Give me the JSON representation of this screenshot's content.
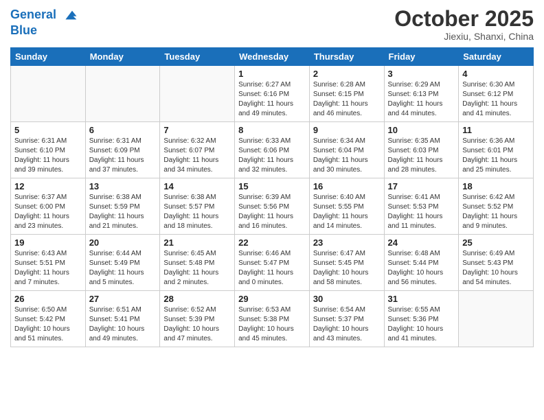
{
  "header": {
    "logo_line1": "General",
    "logo_line2": "Blue",
    "month_title": "October 2025",
    "location": "Jiexiu, Shanxi, China"
  },
  "weekdays": [
    "Sunday",
    "Monday",
    "Tuesday",
    "Wednesday",
    "Thursday",
    "Friday",
    "Saturday"
  ],
  "weeks": [
    [
      {
        "day": "",
        "sunrise": "",
        "sunset": "",
        "daylight": ""
      },
      {
        "day": "",
        "sunrise": "",
        "sunset": "",
        "daylight": ""
      },
      {
        "day": "",
        "sunrise": "",
        "sunset": "",
        "daylight": ""
      },
      {
        "day": "1",
        "sunrise": "Sunrise: 6:27 AM",
        "sunset": "Sunset: 6:16 PM",
        "daylight": "Daylight: 11 hours and 49 minutes."
      },
      {
        "day": "2",
        "sunrise": "Sunrise: 6:28 AM",
        "sunset": "Sunset: 6:15 PM",
        "daylight": "Daylight: 11 hours and 46 minutes."
      },
      {
        "day": "3",
        "sunrise": "Sunrise: 6:29 AM",
        "sunset": "Sunset: 6:13 PM",
        "daylight": "Daylight: 11 hours and 44 minutes."
      },
      {
        "day": "4",
        "sunrise": "Sunrise: 6:30 AM",
        "sunset": "Sunset: 6:12 PM",
        "daylight": "Daylight: 11 hours and 41 minutes."
      }
    ],
    [
      {
        "day": "5",
        "sunrise": "Sunrise: 6:31 AM",
        "sunset": "Sunset: 6:10 PM",
        "daylight": "Daylight: 11 hours and 39 minutes."
      },
      {
        "day": "6",
        "sunrise": "Sunrise: 6:31 AM",
        "sunset": "Sunset: 6:09 PM",
        "daylight": "Daylight: 11 hours and 37 minutes."
      },
      {
        "day": "7",
        "sunrise": "Sunrise: 6:32 AM",
        "sunset": "Sunset: 6:07 PM",
        "daylight": "Daylight: 11 hours and 34 minutes."
      },
      {
        "day": "8",
        "sunrise": "Sunrise: 6:33 AM",
        "sunset": "Sunset: 6:06 PM",
        "daylight": "Daylight: 11 hours and 32 minutes."
      },
      {
        "day": "9",
        "sunrise": "Sunrise: 6:34 AM",
        "sunset": "Sunset: 6:04 PM",
        "daylight": "Daylight: 11 hours and 30 minutes."
      },
      {
        "day": "10",
        "sunrise": "Sunrise: 6:35 AM",
        "sunset": "Sunset: 6:03 PM",
        "daylight": "Daylight: 11 hours and 28 minutes."
      },
      {
        "day": "11",
        "sunrise": "Sunrise: 6:36 AM",
        "sunset": "Sunset: 6:01 PM",
        "daylight": "Daylight: 11 hours and 25 minutes."
      }
    ],
    [
      {
        "day": "12",
        "sunrise": "Sunrise: 6:37 AM",
        "sunset": "Sunset: 6:00 PM",
        "daylight": "Daylight: 11 hours and 23 minutes."
      },
      {
        "day": "13",
        "sunrise": "Sunrise: 6:38 AM",
        "sunset": "Sunset: 5:59 PM",
        "daylight": "Daylight: 11 hours and 21 minutes."
      },
      {
        "day": "14",
        "sunrise": "Sunrise: 6:38 AM",
        "sunset": "Sunset: 5:57 PM",
        "daylight": "Daylight: 11 hours and 18 minutes."
      },
      {
        "day": "15",
        "sunrise": "Sunrise: 6:39 AM",
        "sunset": "Sunset: 5:56 PM",
        "daylight": "Daylight: 11 hours and 16 minutes."
      },
      {
        "day": "16",
        "sunrise": "Sunrise: 6:40 AM",
        "sunset": "Sunset: 5:55 PM",
        "daylight": "Daylight: 11 hours and 14 minutes."
      },
      {
        "day": "17",
        "sunrise": "Sunrise: 6:41 AM",
        "sunset": "Sunset: 5:53 PM",
        "daylight": "Daylight: 11 hours and 11 minutes."
      },
      {
        "day": "18",
        "sunrise": "Sunrise: 6:42 AM",
        "sunset": "Sunset: 5:52 PM",
        "daylight": "Daylight: 11 hours and 9 minutes."
      }
    ],
    [
      {
        "day": "19",
        "sunrise": "Sunrise: 6:43 AM",
        "sunset": "Sunset: 5:51 PM",
        "daylight": "Daylight: 11 hours and 7 minutes."
      },
      {
        "day": "20",
        "sunrise": "Sunrise: 6:44 AM",
        "sunset": "Sunset: 5:49 PM",
        "daylight": "Daylight: 11 hours and 5 minutes."
      },
      {
        "day": "21",
        "sunrise": "Sunrise: 6:45 AM",
        "sunset": "Sunset: 5:48 PM",
        "daylight": "Daylight: 11 hours and 2 minutes."
      },
      {
        "day": "22",
        "sunrise": "Sunrise: 6:46 AM",
        "sunset": "Sunset: 5:47 PM",
        "daylight": "Daylight: 11 hours and 0 minutes."
      },
      {
        "day": "23",
        "sunrise": "Sunrise: 6:47 AM",
        "sunset": "Sunset: 5:45 PM",
        "daylight": "Daylight: 10 hours and 58 minutes."
      },
      {
        "day": "24",
        "sunrise": "Sunrise: 6:48 AM",
        "sunset": "Sunset: 5:44 PM",
        "daylight": "Daylight: 10 hours and 56 minutes."
      },
      {
        "day": "25",
        "sunrise": "Sunrise: 6:49 AM",
        "sunset": "Sunset: 5:43 PM",
        "daylight": "Daylight: 10 hours and 54 minutes."
      }
    ],
    [
      {
        "day": "26",
        "sunrise": "Sunrise: 6:50 AM",
        "sunset": "Sunset: 5:42 PM",
        "daylight": "Daylight: 10 hours and 51 minutes."
      },
      {
        "day": "27",
        "sunrise": "Sunrise: 6:51 AM",
        "sunset": "Sunset: 5:41 PM",
        "daylight": "Daylight: 10 hours and 49 minutes."
      },
      {
        "day": "28",
        "sunrise": "Sunrise: 6:52 AM",
        "sunset": "Sunset: 5:39 PM",
        "daylight": "Daylight: 10 hours and 47 minutes."
      },
      {
        "day": "29",
        "sunrise": "Sunrise: 6:53 AM",
        "sunset": "Sunset: 5:38 PM",
        "daylight": "Daylight: 10 hours and 45 minutes."
      },
      {
        "day": "30",
        "sunrise": "Sunrise: 6:54 AM",
        "sunset": "Sunset: 5:37 PM",
        "daylight": "Daylight: 10 hours and 43 minutes."
      },
      {
        "day": "31",
        "sunrise": "Sunrise: 6:55 AM",
        "sunset": "Sunset: 5:36 PM",
        "daylight": "Daylight: 10 hours and 41 minutes."
      },
      {
        "day": "",
        "sunrise": "",
        "sunset": "",
        "daylight": ""
      }
    ]
  ]
}
